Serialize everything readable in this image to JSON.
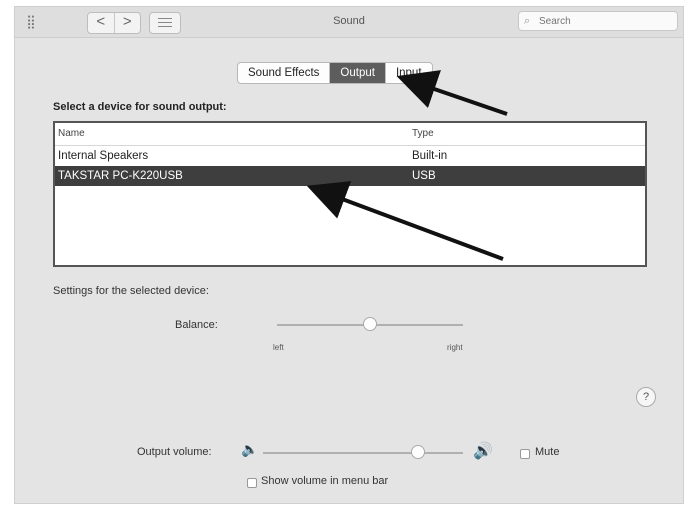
{
  "window": {
    "title": "Sound",
    "nav_back": "<",
    "nav_forward": ">",
    "search_placeholder": "Search"
  },
  "tabs": [
    {
      "label": "Sound Effects",
      "active": false
    },
    {
      "label": "Output",
      "active": true
    },
    {
      "label": "Input",
      "active": false
    }
  ],
  "output": {
    "section_label": "Select a device for sound output:",
    "columns": {
      "name": "Name",
      "type": "Type"
    },
    "devices": [
      {
        "name": "Internal Speakers",
        "type": "Built-in",
        "selected": false
      },
      {
        "name": "TAKSTAR PC-K220USB",
        "type": "USB",
        "selected": true
      }
    ],
    "settings_label": "Settings for the selected device:",
    "balance": {
      "label": "Balance:",
      "left_label": "left",
      "right_label": "right",
      "value": 0.5
    },
    "help_label": "?"
  },
  "volume": {
    "label": "Output volume:",
    "level": 0.75,
    "mute_label": "Mute",
    "mute_checked": false,
    "show_in_menu_bar_label": "Show volume in menu bar",
    "show_in_menu_bar_checked": false
  },
  "colors": {
    "selected_row": "#3e3e3e",
    "active_tab": "#5d5d5d",
    "annotation_arrow": "#111111"
  }
}
